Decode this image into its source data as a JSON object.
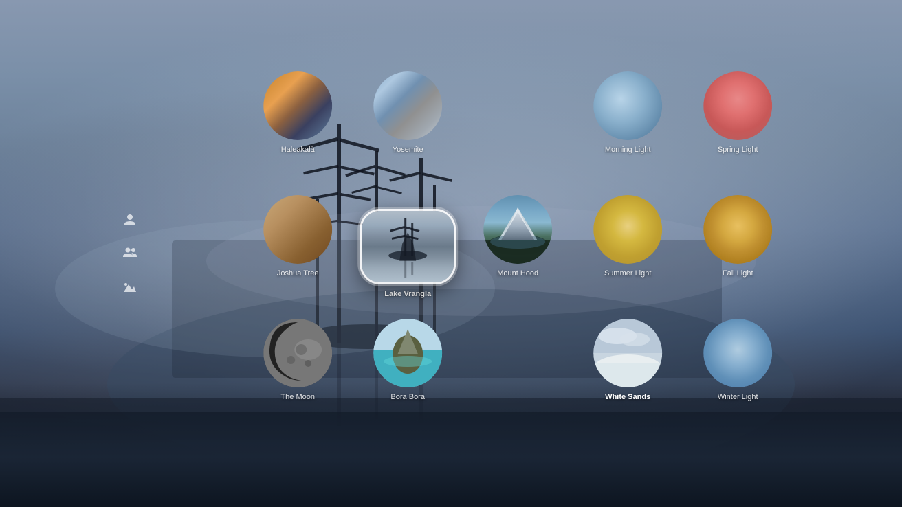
{
  "background": {
    "description": "Foggy lake scene with tree silhouettes"
  },
  "sidebar": {
    "icons": [
      {
        "name": "person-icon",
        "symbol": "⌘",
        "label": "Person"
      },
      {
        "name": "group-icon",
        "symbol": "👤",
        "label": "Group"
      },
      {
        "name": "landscape-icon",
        "symbol": "🏔",
        "label": "Landscape"
      }
    ]
  },
  "wallpapers": {
    "row1": [
      {
        "id": "haleakala",
        "label": "Haleakalā",
        "selected": false,
        "size": 100
      },
      {
        "id": "yosemite",
        "label": "Yosemite",
        "selected": false,
        "size": 100
      },
      {
        "id": "morning-light",
        "label": "Morning Light",
        "selected": false,
        "size": 100
      },
      {
        "id": "spring-light",
        "label": "Spring Light",
        "selected": false,
        "size": 100
      }
    ],
    "row2": [
      {
        "id": "joshua-tree",
        "label": "Joshua Tree",
        "selected": false,
        "size": 100
      },
      {
        "id": "lake-vrangla",
        "label": "Lake Vrangla",
        "selected": true,
        "size": 120
      },
      {
        "id": "mount-hood",
        "label": "Mount Hood",
        "selected": false,
        "size": 100
      },
      {
        "id": "summer-light",
        "label": "Summer Light",
        "selected": false,
        "size": 100
      },
      {
        "id": "fall-light",
        "label": "Fall Light",
        "selected": false,
        "size": 100
      }
    ],
    "row3": [
      {
        "id": "moon",
        "label": "The Moon",
        "selected": false,
        "size": 100
      },
      {
        "id": "bora-bora",
        "label": "Bora Bora",
        "selected": false,
        "size": 100
      },
      {
        "id": "white-sands",
        "label": "White Sands",
        "selected": false,
        "size": 100
      },
      {
        "id": "winter-light",
        "label": "Winter Light",
        "selected": false,
        "size": 100
      }
    ]
  }
}
